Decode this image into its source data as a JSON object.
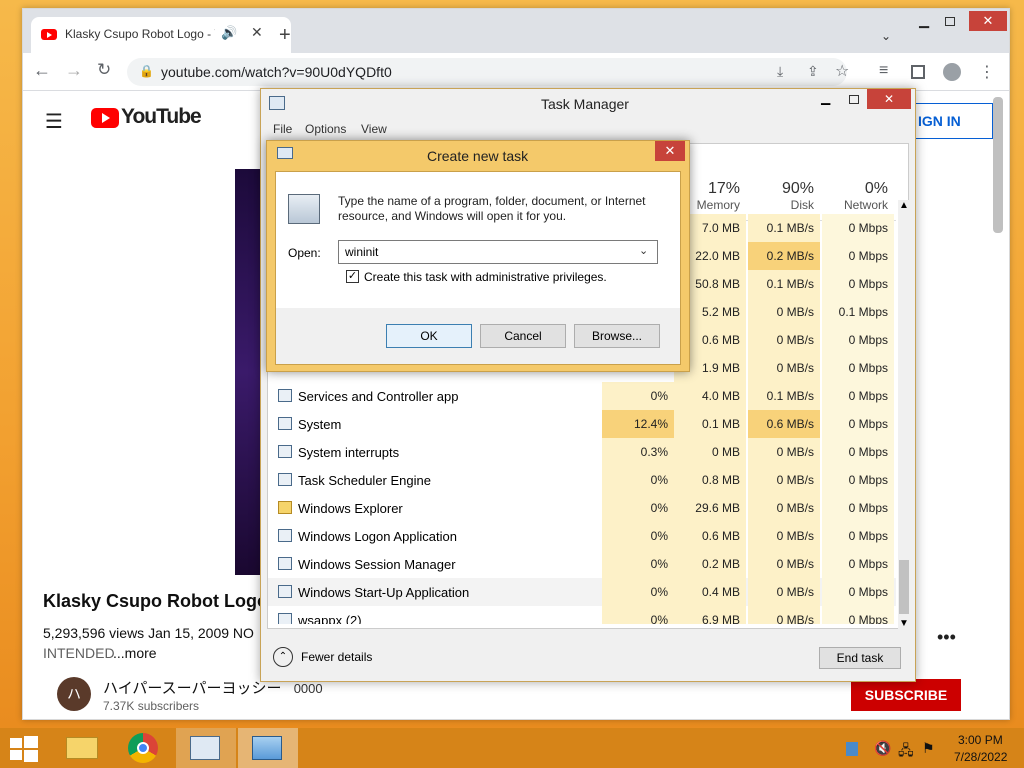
{
  "browser": {
    "tab_title": "Klasky Csupo Robot Logo - Y",
    "tab_audio_icon": "speaker-icon",
    "url": "youtube.com/watch?v=90U0dYQDft0",
    "accent": "#dee1e6"
  },
  "youtube": {
    "logo_text": "YouTube",
    "sign_in": "IGN IN",
    "video_title": "Klasky Csupo Robot Logo",
    "views_date": "5,293,596 views  Jan 15, 2009  NO",
    "intended": "INTENDED",
    "more": "...more",
    "channel_initial": "ハ",
    "channel_name": "ハイパースーパーヨッシー",
    "channel_suffix": "0000",
    "subscribers": "7.37K subscribers",
    "subscribe": "SUBSCRIBE",
    "brand_color": "#ff0000"
  },
  "task_manager": {
    "title": "Task Manager",
    "menu": [
      "File",
      "Options",
      "View"
    ],
    "columns": [
      {
        "pct": "17%",
        "label": "Memory"
      },
      {
        "pct": "90%",
        "label": "Disk"
      },
      {
        "pct": "0%",
        "label": "Network"
      }
    ],
    "top_rows": [
      {
        "mem": "7.0 MB",
        "disk": "0.1 MB/s",
        "net": "0 Mbps"
      },
      {
        "mem": "22.0 MB",
        "disk": "0.2 MB/s",
        "net": "0 Mbps"
      },
      {
        "mem": "50.8 MB",
        "disk": "0.1 MB/s",
        "net": "0 Mbps"
      },
      {
        "mem": "5.2 MB",
        "disk": "0 MB/s",
        "net": "0.1 Mbps"
      },
      {
        "mem": "0.6 MB",
        "disk": "0 MB/s",
        "net": "0 Mbps"
      },
      {
        "mem": "1.9 MB",
        "disk": "0 MB/s",
        "net": "0 Mbps"
      }
    ],
    "rows": [
      {
        "name": "Services and Controller app",
        "cpu": "0%",
        "mem": "4.0 MB",
        "disk": "0.1 MB/s",
        "net": "0 Mbps"
      },
      {
        "name": "System",
        "cpu": "12.4%",
        "mem": "0.1 MB",
        "disk": "0.6 MB/s",
        "net": "0 Mbps"
      },
      {
        "name": "System interrupts",
        "cpu": "0.3%",
        "mem": "0 MB",
        "disk": "0 MB/s",
        "net": "0 Mbps"
      },
      {
        "name": "Task Scheduler Engine",
        "cpu": "0%",
        "mem": "0.8 MB",
        "disk": "0 MB/s",
        "net": "0 Mbps"
      },
      {
        "name": "Windows Explorer",
        "cpu": "0%",
        "mem": "29.6 MB",
        "disk": "0 MB/s",
        "net": "0 Mbps"
      },
      {
        "name": "Windows Logon Application",
        "cpu": "0%",
        "mem": "0.6 MB",
        "disk": "0 MB/s",
        "net": "0 Mbps"
      },
      {
        "name": "Windows Session Manager",
        "cpu": "0%",
        "mem": "0.2 MB",
        "disk": "0 MB/s",
        "net": "0 Mbps"
      },
      {
        "name": "Windows Start-Up Application",
        "cpu": "0%",
        "mem": "0.4 MB",
        "disk": "0 MB/s",
        "net": "0 Mbps"
      },
      {
        "name": "wsappx (2)",
        "cpu": "0%",
        "mem": "6.9 MB",
        "disk": "0 MB/s",
        "net": "0 Mbps"
      }
    ],
    "fewer_details": "Fewer details",
    "end_task": "End task"
  },
  "dialog": {
    "title": "Create new task",
    "description": "Type the name of a program, folder, document, or Internet resource, and Windows will open it for you.",
    "open_label": "Open:",
    "open_value": "wininit",
    "admin_label": "Create this task with administrative privileges.",
    "admin_checked": true,
    "ok": "OK",
    "cancel": "Cancel",
    "browse": "Browse..."
  },
  "taskbar": {
    "time": "3:00 PM",
    "date": "7/28/2022",
    "color": "#d68418"
  }
}
